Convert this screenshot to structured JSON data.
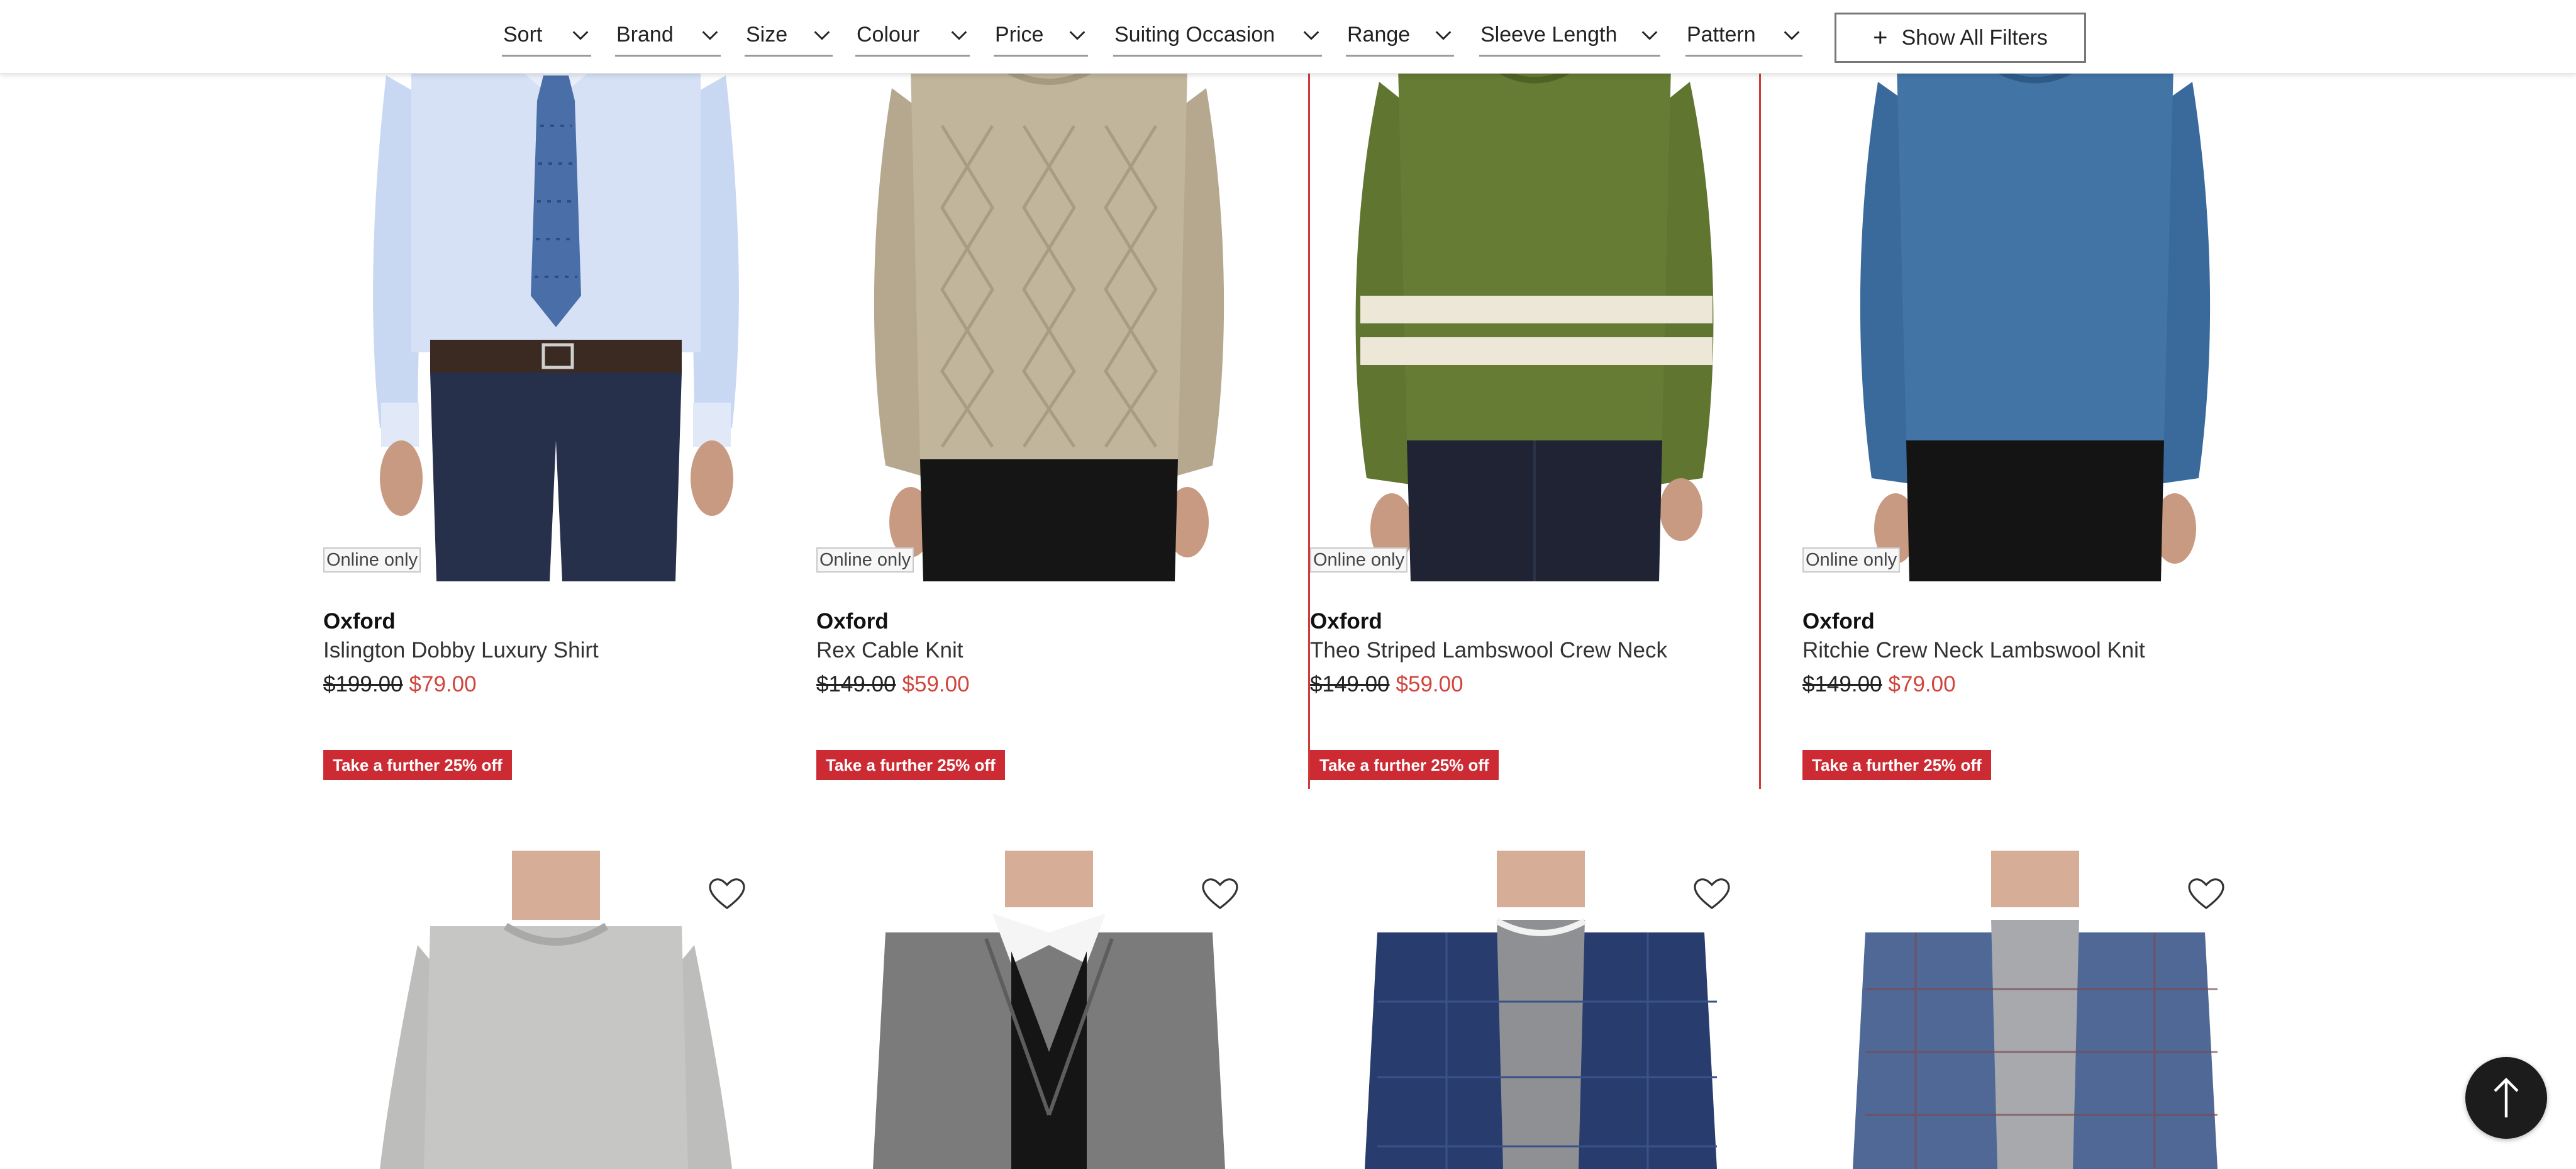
{
  "filters": [
    {
      "label": "Sort"
    },
    {
      "label": "Brand"
    },
    {
      "label": "Size"
    },
    {
      "label": "Colour"
    },
    {
      "label": "Price"
    },
    {
      "label": "Suiting Occasion"
    },
    {
      "label": "Range"
    },
    {
      "label": "Sleeve Length"
    },
    {
      "label": "Pattern"
    }
  ],
  "show_all_filters": {
    "icon": "plus-icon",
    "label": "Show All Filters"
  },
  "products": [
    {
      "badge": "Online only",
      "brand": "Oxford",
      "name": "Islington Dobby Luxury Shirt",
      "was": "$199.00",
      "now": "$79.00",
      "promo": "Take a further 25% off"
    },
    {
      "badge": "Online only",
      "brand": "Oxford",
      "name": "Rex Cable Knit",
      "was": "$149.00",
      "now": "$59.00",
      "promo": "Take a further 25% off"
    },
    {
      "badge": "Online only",
      "brand": "Oxford",
      "name": "Theo Striped Lambswool Crew Neck",
      "was": "$149.00",
      "now": "$59.00",
      "promo": "Take a further 25% off"
    },
    {
      "badge": "Online only",
      "brand": "Oxford",
      "name": "Ritchie Crew Neck Lambswool Knit",
      "was": "$149.00",
      "now": "$79.00",
      "promo": "Take a further 25% off"
    }
  ],
  "wishlist_icon": "heart-icon",
  "scroll_to_top_icon": "arrow-up-icon",
  "colors": {
    "sale_price": "#d0453c",
    "promo_badge": "#cc2b34",
    "highlight_border": "#d03a3a"
  }
}
